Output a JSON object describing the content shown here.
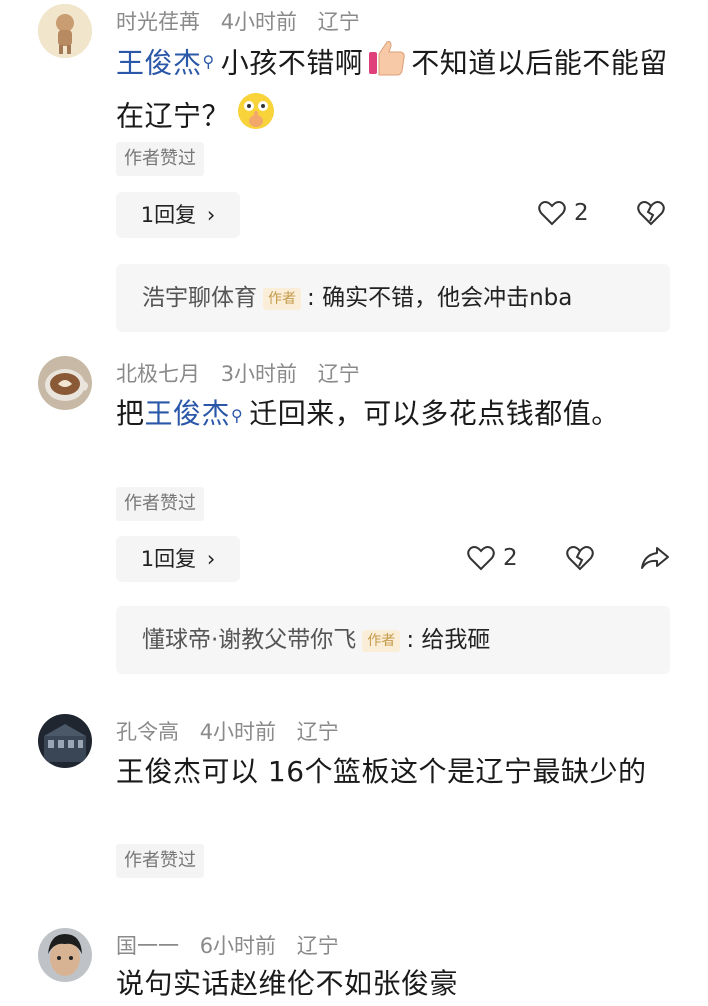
{
  "comments": [
    {
      "user": "时光荏苒",
      "time": "4小时前",
      "location": "辽宁",
      "mention": "王俊杰",
      "text_a": "小孩不错啊",
      "text_b": "不知道以后能不能留在辽宁？",
      "emoji_a": "thumbs-up-emoji",
      "emoji_b": "shush-face-emoji",
      "author_liked": "作者赞过",
      "reply_label": "1回复",
      "likes": "2",
      "reply": {
        "name": "浩宇聊体育",
        "badge": "作者",
        "text": "确实不错，他会冲击nba"
      }
    },
    {
      "user": "北极七月",
      "time": "3小时前",
      "location": "辽宁",
      "prefix": "把",
      "mention": "王俊杰",
      "text": "迁回来，可以多花点钱都值。",
      "author_liked": "作者赞过",
      "reply_label": "1回复",
      "likes": "2",
      "reply": {
        "name": "懂球帝·谢教父带你飞",
        "badge": "作者",
        "text": "给我砸"
      }
    },
    {
      "user": "孔令高",
      "time": "4小时前",
      "location": "辽宁",
      "text": "王俊杰可以 16个篮板这个是辽宁最缺少的",
      "author_liked": "作者赞过"
    },
    {
      "user": "国一一",
      "time": "6小时前",
      "location": "辽宁",
      "text": "说句实话赵维伦不如张俊豪"
    }
  ],
  "reply_chevron": "›",
  "colors": {
    "mention": "#2a57a8",
    "meta": "#8a8a8a",
    "author_badge_bg": "#fbeed8",
    "author_badge_text": "#c49a4a"
  }
}
